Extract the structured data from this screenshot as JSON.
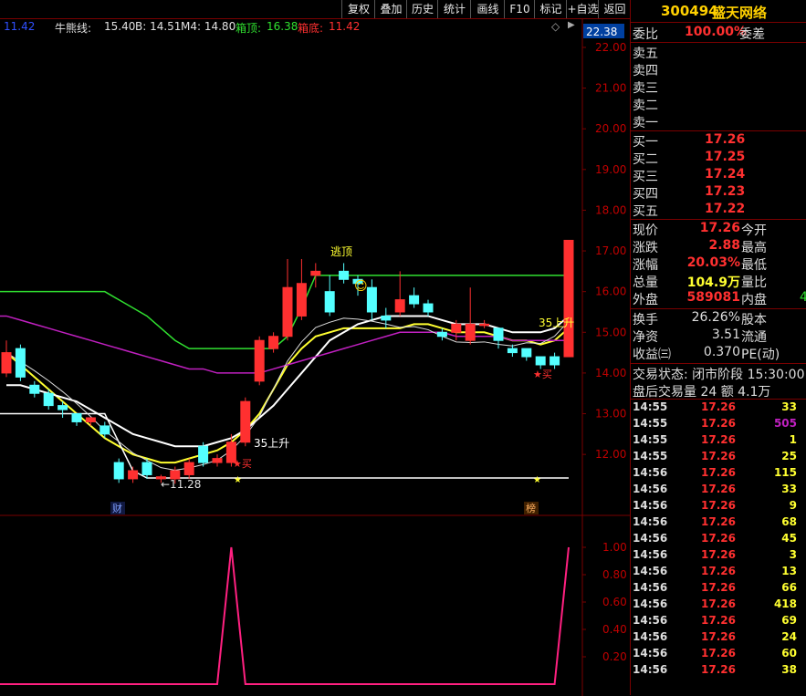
{
  "toolbar": {
    "buttons": [
      "复权",
      "叠加",
      "历史",
      "统计",
      "画线",
      "F10",
      "标记",
      "+自选",
      "返回"
    ]
  },
  "indicator_header": {
    "top_left_value": "11.42",
    "name": "牛熊线:",
    "name_value": "15.40",
    "b": "B: 14.51",
    "m4": "M4: 14.80",
    "box_top_label": "箱顶:",
    "box_top_value": "16.38",
    "box_bottom_label": "箱底:",
    "box_bottom_value": "11.42",
    "diamond": "◇",
    "arrow": "▶"
  },
  "price_axis": {
    "top_badge": "22.38",
    "ticks": [
      "22.00",
      "21.00",
      "20.00",
      "19.00",
      "18.00",
      "17.00",
      "16.00",
      "15.00",
      "14.00",
      "13.00",
      "12.00"
    ]
  },
  "sub_axis": {
    "ticks": [
      "1.00",
      "0.80",
      "0.60",
      "0.40",
      "0.20"
    ]
  },
  "annotations": {
    "escape_top": "逃顶",
    "rise35_a": "35上升",
    "rise35_b": "35上升",
    "buy_a": "★买",
    "buy_b": "★买",
    "low_price": "←11.28",
    "cai": "财",
    "bang": "榜",
    "smile": "☺"
  },
  "colors": {
    "up": "#ff3030",
    "down": "#54ffff",
    "green": "#30e030",
    "yellow": "#ffff30",
    "magenta": "#c020c0",
    "white": "#ffffff",
    "grid": "#7a0000"
  },
  "chart_data": {
    "type": "candlestick",
    "candles": [
      {
        "o": 14.0,
        "c": 14.5,
        "h": 14.8,
        "l": 13.9
      },
      {
        "o": 14.6,
        "c": 13.9,
        "h": 14.7,
        "l": 13.8
      },
      {
        "o": 13.7,
        "c": 13.5,
        "h": 13.8,
        "l": 13.4
      },
      {
        "o": 13.5,
        "c": 13.2,
        "h": 13.6,
        "l": 13.1
      },
      {
        "o": 13.2,
        "c": 13.1,
        "h": 13.3,
        "l": 12.9
      },
      {
        "o": 13.0,
        "c": 12.8,
        "h": 13.0,
        "l": 12.7
      },
      {
        "o": 12.8,
        "c": 12.9,
        "h": 12.9,
        "l": 12.7
      },
      {
        "o": 12.7,
        "c": 12.5,
        "h": 12.8,
        "l": 12.4
      },
      {
        "o": 11.8,
        "c": 11.4,
        "h": 11.9,
        "l": 11.3
      },
      {
        "o": 11.4,
        "c": 11.6,
        "h": 11.7,
        "l": 11.3
      },
      {
        "o": 11.8,
        "c": 11.5,
        "h": 11.9,
        "l": 11.4
      },
      {
        "o": 11.4,
        "c": 11.45,
        "h": 11.5,
        "l": 11.3
      },
      {
        "o": 11.4,
        "c": 11.6,
        "h": 11.7,
        "l": 11.28
      },
      {
        "o": 11.5,
        "c": 11.8,
        "h": 11.9,
        "l": 11.4
      },
      {
        "o": 12.2,
        "c": 11.8,
        "h": 12.3,
        "l": 11.7
      },
      {
        "o": 11.8,
        "c": 11.9,
        "h": 12.0,
        "l": 11.7
      },
      {
        "o": 11.8,
        "c": 12.3,
        "h": 12.5,
        "l": 11.7
      },
      {
        "o": 12.3,
        "c": 13.3,
        "h": 13.4,
        "l": 12.2
      },
      {
        "o": 13.8,
        "c": 14.8,
        "h": 14.9,
        "l": 13.7
      },
      {
        "o": 14.6,
        "c": 14.9,
        "h": 15.0,
        "l": 14.5
      },
      {
        "o": 14.9,
        "c": 16.1,
        "h": 16.8,
        "l": 14.8
      },
      {
        "o": 15.4,
        "c": 16.2,
        "h": 16.8,
        "l": 15.3
      },
      {
        "o": 16.4,
        "c": 16.5,
        "h": 16.7,
        "l": 16.1
      },
      {
        "o": 16.0,
        "c": 15.5,
        "h": 16.4,
        "l": 15.4
      },
      {
        "o": 16.5,
        "c": 16.3,
        "h": 16.7,
        "l": 16.2
      },
      {
        "o": 16.3,
        "c": 16.2,
        "h": 16.4,
        "l": 15.9
      },
      {
        "o": 16.1,
        "c": 15.5,
        "h": 16.3,
        "l": 15.3
      },
      {
        "o": 15.4,
        "c": 15.3,
        "h": 15.6,
        "l": 15.1
      },
      {
        "o": 15.5,
        "c": 15.8,
        "h": 16.5,
        "l": 15.4
      },
      {
        "o": 15.9,
        "c": 15.7,
        "h": 16.1,
        "l": 15.6
      },
      {
        "o": 15.7,
        "c": 15.5,
        "h": 15.8,
        "l": 15.4
      },
      {
        "o": 15.0,
        "c": 14.9,
        "h": 15.1,
        "l": 14.8
      },
      {
        "o": 15.0,
        "c": 15.2,
        "h": 15.3,
        "l": 14.8
      },
      {
        "o": 14.8,
        "c": 15.2,
        "h": 16.1,
        "l": 14.7
      },
      {
        "o": 15.2,
        "c": 15.2,
        "h": 15.3,
        "l": 15.1
      },
      {
        "o": 15.1,
        "c": 14.8,
        "h": 15.1,
        "l": 14.6
      },
      {
        "o": 14.6,
        "c": 14.5,
        "h": 14.7,
        "l": 14.4
      },
      {
        "o": 14.6,
        "c": 14.4,
        "h": 14.6,
        "l": 14.3
      },
      {
        "o": 14.4,
        "c": 14.2,
        "h": 14.4,
        "l": 14.1
      },
      {
        "o": 14.4,
        "c": 14.2,
        "h": 14.5,
        "l": 14.1
      },
      {
        "o": 14.4,
        "c": 17.26,
        "h": 17.26,
        "l": 14.4
      }
    ],
    "series": [
      {
        "color": "green",
        "values": [
          16.0,
          16.0,
          16.0,
          16.0,
          16.0,
          16.0,
          16.0,
          16.0,
          15.8,
          15.6,
          15.4,
          15.1,
          14.8,
          14.6,
          14.6,
          14.6,
          14.6,
          14.6,
          14.6,
          14.6,
          14.9,
          15.6,
          16.4,
          16.4,
          16.4,
          16.4,
          16.4,
          16.4,
          16.4,
          16.4,
          16.4,
          16.4,
          16.4,
          16.4,
          16.4,
          16.4,
          16.4,
          16.4,
          16.4,
          16.4,
          16.4
        ]
      },
      {
        "color": "yellow",
        "values": [
          14.5,
          14.2,
          13.9,
          13.6,
          13.3,
          13.0,
          12.7,
          12.4,
          12.2,
          12.0,
          11.9,
          11.8,
          11.8,
          11.9,
          12.0,
          12.1,
          12.3,
          12.6,
          13.0,
          13.6,
          14.2,
          14.6,
          14.9,
          15.0,
          15.1,
          15.1,
          15.1,
          15.1,
          15.1,
          15.2,
          15.2,
          15.1,
          15.0,
          15.0,
          15.0,
          14.9,
          14.8,
          14.8,
          14.7,
          14.8,
          15.1
        ]
      },
      {
        "color": "white",
        "values": [
          13.7,
          13.7,
          13.6,
          13.5,
          13.4,
          13.3,
          13.1,
          12.9,
          12.7,
          12.5,
          12.4,
          12.3,
          12.2,
          12.2,
          12.2,
          12.3,
          12.4,
          12.6,
          12.9,
          13.2,
          13.6,
          14.0,
          14.4,
          14.8,
          15.0,
          15.2,
          15.3,
          15.4,
          15.4,
          15.4,
          15.4,
          15.3,
          15.2,
          15.2,
          15.2,
          15.1,
          15.0,
          15.0,
          15.0,
          15.1,
          15.4
        ]
      },
      {
        "color": "magenta",
        "values": [
          15.4,
          15.3,
          15.2,
          15.1,
          15.0,
          14.9,
          14.8,
          14.7,
          14.6,
          14.5,
          14.4,
          14.3,
          14.2,
          14.1,
          14.1,
          14.0,
          14.0,
          14.0,
          14.0,
          14.1,
          14.2,
          14.3,
          14.4,
          14.5,
          14.6,
          14.7,
          14.8,
          14.9,
          15.0,
          15.0,
          15.0,
          15.0,
          14.9,
          14.9,
          14.9,
          14.9,
          14.8,
          14.8,
          14.8,
          14.8,
          14.8
        ]
      },
      {
        "color": "red",
        "values": [
          13.0,
          13.0,
          13.0,
          13.0,
          13.0,
          13.0,
          13.0,
          13.0,
          12.3,
          11.6,
          11.42,
          11.42,
          11.42,
          11.42,
          11.42,
          11.42,
          11.42,
          11.42,
          11.42,
          11.42,
          11.42,
          11.42,
          11.42,
          11.42,
          11.42,
          11.42,
          11.42,
          11.42,
          11.42,
          11.42,
          11.42,
          11.42,
          11.42,
          11.42,
          11.42,
          11.42,
          11.42,
          11.42,
          11.42,
          11.42,
          11.42
        ]
      }
    ],
    "subchart": {
      "values": [
        0,
        0,
        0,
        0,
        0,
        0,
        0,
        0,
        0,
        0,
        0,
        0,
        0,
        0,
        0,
        0,
        1,
        0,
        0,
        0,
        0,
        0,
        0,
        0,
        0,
        0,
        0,
        0,
        0,
        0,
        0,
        0,
        0,
        0,
        0,
        0,
        0,
        0,
        0,
        0,
        1
      ],
      "ylim": [
        0,
        1.1
      ]
    },
    "ylim": [
      10.95,
      22.38
    ]
  },
  "quote": {
    "code": "300494",
    "name": "盛天网络",
    "ratio_label": "委比",
    "ratio_value": "100.00%",
    "diff_label": "委差",
    "asks": [
      "卖五",
      "卖四",
      "卖三",
      "卖二",
      "卖一"
    ],
    "bids": [
      {
        "label": "买一",
        "price": "17.26"
      },
      {
        "label": "买二",
        "price": "17.25"
      },
      {
        "label": "买三",
        "price": "17.24"
      },
      {
        "label": "买四",
        "price": "17.23"
      },
      {
        "label": "买五",
        "price": "17.22"
      }
    ],
    "stats": [
      {
        "label": "现价",
        "value": "17.26",
        "label2": "今开",
        "color": "#ff3030"
      },
      {
        "label": "涨跌",
        "value": "2.88",
        "label2": "最高",
        "color": "#ff3030"
      },
      {
        "label": "涨幅",
        "value": "20.03%",
        "label2": "最低",
        "color": "#ff3030"
      },
      {
        "label": "总量",
        "value": "104.9万",
        "label2": "量比",
        "color": "#ffff30"
      },
      {
        "label": "外盘",
        "value": "589081",
        "label2": "内盘",
        "color": "#ff3030",
        "extra": "4"
      }
    ],
    "stats2": [
      {
        "label": "换手",
        "value": "26.26%",
        "label2": "股本"
      },
      {
        "label": "净资",
        "value": "3.51",
        "label2": "流通"
      },
      {
        "label": "收益㈢",
        "value": "0.370",
        "label2": "PE(动)"
      }
    ],
    "status_line": "交易状态: 闭市阶段 15:30:00",
    "after_line": "盘后交易量 24 额 4.1万",
    "ticks": [
      {
        "t": "14:55",
        "p": "17.26",
        "v": "33",
        "vc": "#ffff30"
      },
      {
        "t": "14:55",
        "p": "17.26",
        "v": "505",
        "vc": "#c020c0"
      },
      {
        "t": "14:55",
        "p": "17.26",
        "v": "1",
        "vc": "#ffff30"
      },
      {
        "t": "14:55",
        "p": "17.26",
        "v": "25",
        "vc": "#ffff30"
      },
      {
        "t": "14:56",
        "p": "17.26",
        "v": "115",
        "vc": "#ffff30"
      },
      {
        "t": "14:56",
        "p": "17.26",
        "v": "33",
        "vc": "#ffff30"
      },
      {
        "t": "14:56",
        "p": "17.26",
        "v": "9",
        "vc": "#ffff30"
      },
      {
        "t": "14:56",
        "p": "17.26",
        "v": "68",
        "vc": "#ffff30"
      },
      {
        "t": "14:56",
        "p": "17.26",
        "v": "45",
        "vc": "#ffff30"
      },
      {
        "t": "14:56",
        "p": "17.26",
        "v": "3",
        "vc": "#ffff30"
      },
      {
        "t": "14:56",
        "p": "17.26",
        "v": "13",
        "vc": "#ffff30"
      },
      {
        "t": "14:56",
        "p": "17.26",
        "v": "66",
        "vc": "#ffff30"
      },
      {
        "t": "14:56",
        "p": "17.26",
        "v": "418",
        "vc": "#ffff30"
      },
      {
        "t": "14:56",
        "p": "17.26",
        "v": "69",
        "vc": "#ffff30"
      },
      {
        "t": "14:56",
        "p": "17.26",
        "v": "24",
        "vc": "#ffff30"
      },
      {
        "t": "14:56",
        "p": "17.26",
        "v": "60",
        "vc": "#ffff30"
      },
      {
        "t": "14:56",
        "p": "17.26",
        "v": "38",
        "vc": "#ffff30"
      }
    ]
  }
}
